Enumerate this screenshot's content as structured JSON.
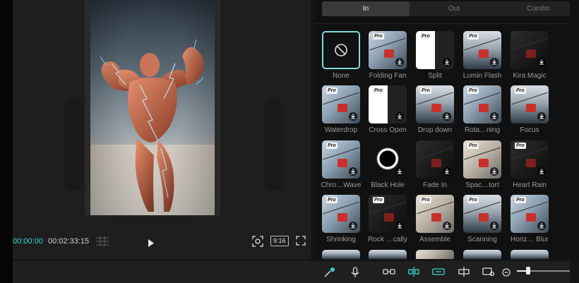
{
  "player": {
    "current_time": "00:00:00",
    "total_time": "00:02:33:15",
    "aspect_ratio": "9:16"
  },
  "transitions": {
    "tabs": [
      {
        "label": "In",
        "active": true
      },
      {
        "label": "Out",
        "active": false
      },
      {
        "label": "Combo",
        "active": false
      }
    ],
    "items": [
      {
        "label": "None"
      },
      {
        "label": "Folding Fan"
      },
      {
        "label": "Split"
      },
      {
        "label": "Lumin Flash"
      },
      {
        "label": "Kira Magic"
      },
      {
        "label": "Waterdrop"
      },
      {
        "label": "Cross Open"
      },
      {
        "label": "Drop down"
      },
      {
        "label": "Rota…ning"
      },
      {
        "label": "Focus"
      },
      {
        "label": "Chro…Wave"
      },
      {
        "label": "Black Hole"
      },
      {
        "label": "Fade In"
      },
      {
        "label": "Spac…tort"
      },
      {
        "label": "Heart Rain"
      },
      {
        "label": "Shrinking"
      },
      {
        "label": "Rock …cally"
      },
      {
        "label": "Assemble"
      },
      {
        "label": "Scanning"
      },
      {
        "label": "Horiz… Blur"
      }
    ],
    "pro_badge": "Pro"
  },
  "colors": {
    "accent": "#3fd1d1",
    "panel_bg": "#111111",
    "gondola": "#c9302c"
  },
  "zoom_slider_level": 0.18
}
